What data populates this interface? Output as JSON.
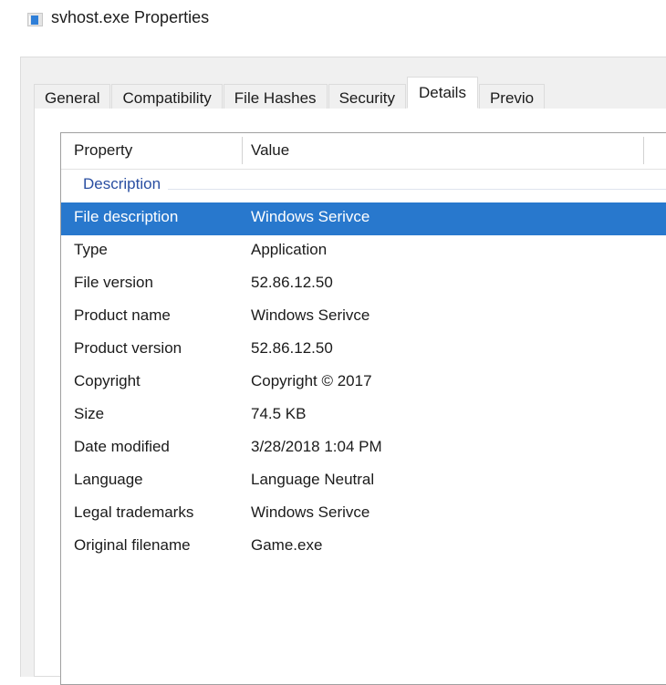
{
  "window": {
    "title": "svhost.exe Properties",
    "icon": "application-window-icon"
  },
  "tabs": [
    {
      "label": "General",
      "active": false
    },
    {
      "label": "Compatibility",
      "active": false
    },
    {
      "label": "File Hashes",
      "active": false
    },
    {
      "label": "Security",
      "active": false
    },
    {
      "label": "Details",
      "active": true
    },
    {
      "label": "Previo",
      "active": false
    }
  ],
  "list": {
    "columns": [
      "Property",
      "Value"
    ],
    "groups": [
      {
        "label": "Description",
        "rows": [
          {
            "property": "File description",
            "value": "Windows Serivce",
            "selected": true
          },
          {
            "property": "Type",
            "value": "Application",
            "selected": false
          },
          {
            "property": "File version",
            "value": "52.86.12.50",
            "selected": false
          },
          {
            "property": "Product name",
            "value": "Windows Serivce",
            "selected": false
          },
          {
            "property": "Product version",
            "value": "52.86.12.50",
            "selected": false
          },
          {
            "property": "Copyright",
            "value": "Copyright ©  2017",
            "selected": false
          },
          {
            "property": "Size",
            "value": "74.5 KB",
            "selected": false
          },
          {
            "property": "Date modified",
            "value": "3/28/2018 1:04 PM",
            "selected": false
          },
          {
            "property": "Language",
            "value": "Language Neutral",
            "selected": false
          },
          {
            "property": "Legal trademarks",
            "value": "Windows Serivce",
            "selected": false
          },
          {
            "property": "Original filename",
            "value": "Game.exe",
            "selected": false
          }
        ]
      }
    ]
  },
  "colors": {
    "selection": "#2878cd",
    "group_label": "#2a4fa2",
    "dialog_background": "#f0f0f0",
    "page_background": "#ffffff",
    "icon_accent": "#2f7fd8"
  }
}
